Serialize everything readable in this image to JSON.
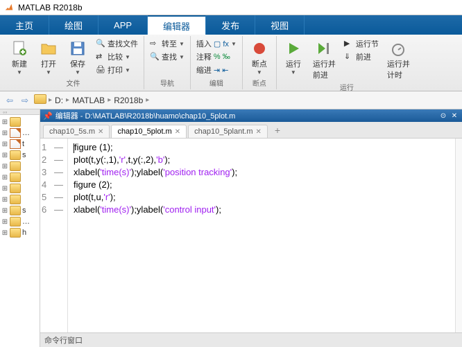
{
  "title": "MATLAB R2018b",
  "menu": {
    "tabs": [
      "主页",
      "绘图",
      "APP",
      "编辑器",
      "发布",
      "视图"
    ],
    "active_index": 3
  },
  "toolstrip": {
    "new": "新建",
    "open": "打开",
    "save": "保存",
    "find_files": "查找文件",
    "compare": "比较",
    "print": "打印",
    "go_to": "转至",
    "find": "查找",
    "insert": "插入",
    "comment": "注释",
    "indent": "缩进",
    "breakpoint": "断点",
    "run": "运行",
    "run_advance": "运行并\n前进",
    "run_section": "运行节",
    "advance": "前进",
    "run_time": "运行并\n计时",
    "group_file": "文件",
    "group_nav": "导航",
    "group_edit": "编辑",
    "group_bp": "断点",
    "group_run": "运行"
  },
  "breadcrumb": {
    "items": [
      "D:",
      "MATLAB",
      "R2018b"
    ]
  },
  "sidebar": {
    "items": [
      " ",
      "…",
      "t",
      "s",
      " ",
      " ",
      " ",
      " ",
      "s",
      "…",
      "h"
    ]
  },
  "editor": {
    "header": "编辑器 - D:\\MATLAB\\R2018b\\huamo\\chap10_5plot.m",
    "tabs": [
      {
        "label": "chap10_5s.m"
      },
      {
        "label": "chap10_5plot.m"
      },
      {
        "label": "chap10_5plant.m"
      }
    ],
    "active_tab": 1,
    "code": [
      {
        "n": 1,
        "plain": "figure (1);"
      },
      {
        "n": 2,
        "tokens": [
          "plot(t,y(:,1),",
          "'r'",
          ",t,y(:,2),",
          "'b'",
          ");"
        ]
      },
      {
        "n": 3,
        "tokens": [
          "xlabel(",
          "'time(s)'",
          ");ylabel(",
          "'position tracking'",
          ");"
        ]
      },
      {
        "n": 4,
        "plain": "figure (2);"
      },
      {
        "n": 5,
        "tokens": [
          "plot(t,u,",
          "'r'",
          ");"
        ]
      },
      {
        "n": 6,
        "tokens": [
          "xlabel(",
          "'time(s)'",
          ");ylabel(",
          "'control input'",
          ");"
        ]
      }
    ]
  },
  "bottom_panel": "命令行窗口",
  "icons": {
    "logo": "matlab",
    "new": "plus-doc",
    "open": "folder-open",
    "save": "disk",
    "run": "play-green"
  }
}
